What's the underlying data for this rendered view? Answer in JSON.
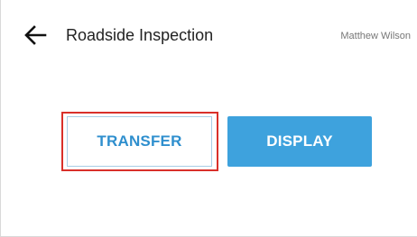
{
  "header": {
    "back_icon": "arrow-left-icon",
    "title": "Roadside Inspection",
    "user_name": "Matthew Wilson"
  },
  "actions": {
    "transfer_label": "TRANSFER",
    "display_label": "DISPLAY"
  },
  "colors": {
    "accent": "#3ea2dd",
    "highlight": "#d9302a"
  }
}
